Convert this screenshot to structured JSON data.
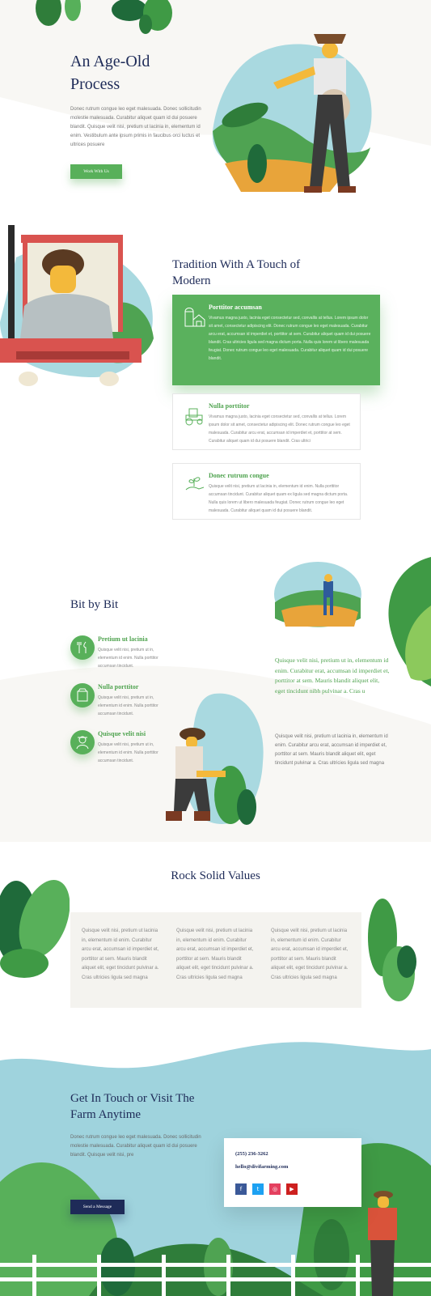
{
  "colors": {
    "navy": "#1e2b58",
    "green": "#58b05a",
    "dark_green": "#3f8f43",
    "sky": "#9fd3dd",
    "cream": "#f8f7f4"
  },
  "hero": {
    "title_line1": "An Age-Old",
    "title_line2": "Process",
    "body": "Donec rutrum congue leo eget malesuada. Donec sollicitudin molestie malesuada. Curabitur aliquet quam id dui posuere blandit. Quisque velit nisi, pretium ut lacinia in, elementum id enim. Vestibulum ante ipsum primis in faucibus orci luctus et ultrices posuere",
    "button_label": "Work With Us"
  },
  "tradition": {
    "title_line1": "Tradition With A Touch of",
    "title_line2": "Modern",
    "cards": [
      {
        "icon": "barn-icon",
        "title": "Porttitor accumsan",
        "text": "Vivamus magna justo, lacinia eget consectetur sed, convallis at tellus. Lorem ipsum dolor sit amet, consectetur adipiscing elit. Donec rutrum congue leo eget malesuada. Curabitur arcu erat, accumsan id imperdiet et, porttitor at sem. Curabitur aliquet quam id dui posuere blandit. Cras ultricies ligula sed magna dictum porta. Nulla quis lorem ut libero malesuada feugiat. Donec rutrum congue leo eget malesuada. Curabitur aliquet quam id dui posuere blandit."
      },
      {
        "icon": "tractor-icon",
        "title": "Nulla porttitor",
        "text": "Vivamus magna justo, lacinia eget consectetur sed, convallis at tellus. Lorem ipsum dolor sit amet, consectetur adipiscing elit. Donec rutrum congue leo eget malesuada. Curabitur arcu erat, accumsan id imperdiet et, porttitor at sem. Curabitur aliquet quam id dui posuere blandit. Cras ultrici"
      },
      {
        "icon": "seedling-hand-icon",
        "title": "Donec rutrum congue",
        "text": "Quisque velit nisi, pretium ut lacinia in, elementum id enim. Nulla porttitor accumsan tincidunt. Curabitur aliquet quam ex ligula sed magna dictum porta. Nulla quis lorem ut libero malesuada feugiat. Donec rutrum congue leo eget malesuada. Curabitur aliquet quam id dui posuere blandit."
      }
    ]
  },
  "bitbybit": {
    "title": "Bit by Bit",
    "items": [
      {
        "icon": "tools-icon",
        "title": "Pretium ut lacinia",
        "text": "Quisque velit nisi, pretium ut in, elementum id enim. Nulla porttitor accumsan tincidunt."
      },
      {
        "icon": "seed-bag-icon",
        "title": "Nulla porttitor",
        "text": "Quisque velit nisi, pretium ut in, elementum id enim. Nulla porttitor accumsan tincidunt."
      },
      {
        "icon": "farmer-icon",
        "title": "Quisque velit nisi",
        "text": "Quisque velit nisi, pretium ut in, elementum id enim. Nulla porttitor accumsan tincidunt."
      }
    ],
    "quote": "Quisque velit nisi, pretium ut in, elementum id enim. Curabitur erat, accumsan id imperdiet et, porttitor at sem. Mauris blandit aliquet elit, eget tincidunt nibh pulvinar a. Cras u",
    "paragraph": "Quisque velit nisi, pretium ut lacinia in, elementum id enim. Curabitur arcu erat, accumsan id imperdiet et, porttitor at sem. Mauris blandit aliquet elit, eget tincidunt pulvinar a. Cras ultricies ligula sed magna"
  },
  "values": {
    "title": "Rock Solid Values",
    "columns": [
      "Quisque velit nisi, pretium ut lacinia in, elementum id enim. Curabitur arcu erat, accumsan id imperdiet et, porttitor at sem. Mauris blandit aliquet elit, eget tincidunt pulvinar a. Cras ultricies ligula sed magna",
      "Quisque velit nisi, pretium ut lacinia in, elementum id enim. Curabitur arcu erat, accumsan id imperdiet et, porttitor at sem. Mauris blandit aliquet elit, eget tincidunt pulvinar a. Cras ultricies ligula sed magna",
      "Quisque velit nisi, pretium ut lacinia in, elementum id enim. Curabitur arcu erat, accumsan id imperdiet et, porttitor at sem. Mauris blandit aliquet elit, eget tincidunt pulvinar a. Cras ultricies ligula sed magna"
    ]
  },
  "contact": {
    "title_line1": "Get In Touch or Visit The",
    "title_line2": "Farm Anytime",
    "body": "Donec rutrum congue leo eget malesuada. Donec sollicitudin molestie malesuada. Curabitur aliquet quam id dui posuere blandit. Quisque velit nisi, pre",
    "button_label": "Send a Message",
    "phone": "(255) 236-3262",
    "email": "hello@divifarming.com",
    "socials": [
      {
        "name": "facebook",
        "glyph": "f",
        "color": "#3b5998"
      },
      {
        "name": "twitter",
        "glyph": "t",
        "color": "#1da1f2"
      },
      {
        "name": "instagram",
        "glyph": "◎",
        "color": "#e4405f"
      },
      {
        "name": "youtube",
        "glyph": "▶",
        "color": "#cd201f"
      }
    ]
  }
}
